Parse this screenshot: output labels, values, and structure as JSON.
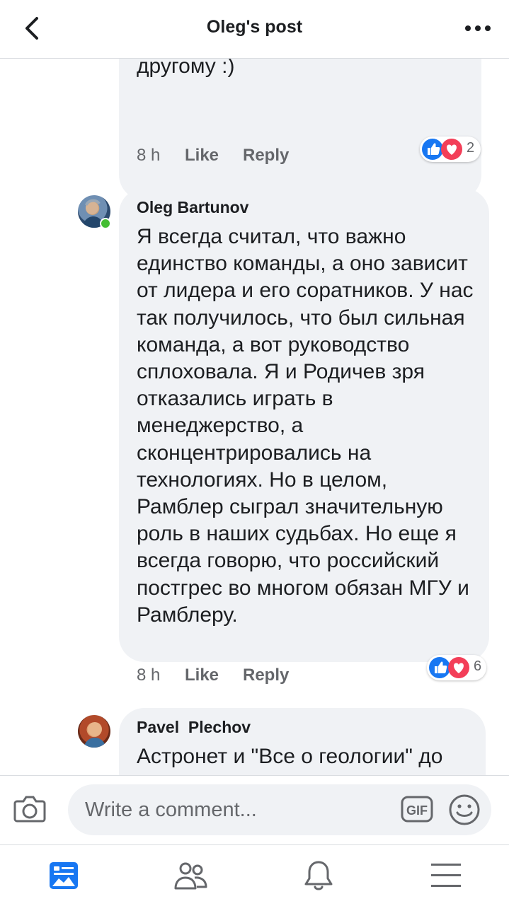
{
  "header": {
    "title": "Oleg's post",
    "back_icon": "chevron-left-icon",
    "more_icon": "more-horizontal-icon"
  },
  "comments": [
    {
      "author": "",
      "text": "Я, если подумаю, то тоже\nобъясню... А Олег объяснит по-\nдругому :)",
      "time": "8 h",
      "like_label": "Like",
      "reply_label": "Reply",
      "reaction_count": "2",
      "reactions": [
        "like-icon",
        "love-icon"
      ]
    },
    {
      "author": "Oleg Bartunov",
      "online": true,
      "text": "Я всегда считал, что важно единство команды, а оно зависит от лидера и его соратников. У нас так получилось, что был сильная команда, а вот руководство сплоховала. Я и Родичев зря отказались играть в менеджерство, а сконцентрировались на технологиях. Но в целом, Рамблер сыграл значительную роль в наших судьбах. Но еще я всегда говорю, что российский постгрес во многом обязан МГУ и Рамблеру.",
      "time": "8 h",
      "like_label": "Like",
      "reply_label": "Reply",
      "reaction_count": "6",
      "reactions": [
        "like-icon",
        "love-icon"
      ]
    },
    {
      "author": "Pavel  Plechov",
      "text": "Астронет и \"Все о геологии\" до"
    }
  ],
  "composer": {
    "placeholder": "Write a comment...",
    "camera_icon": "camera-icon",
    "gif_label": "GIF",
    "emoji_icon": "smiley-icon"
  },
  "tabbar": {
    "items": [
      "news-feed-icon",
      "friends-icon",
      "notifications-icon",
      "menu-icon"
    ],
    "active": "news-feed-icon"
  },
  "colors": {
    "accent": "#1877f2",
    "like": "#1877f2",
    "love": "#f33e58",
    "bubble": "#f0f2f5",
    "online": "#44bd32"
  }
}
